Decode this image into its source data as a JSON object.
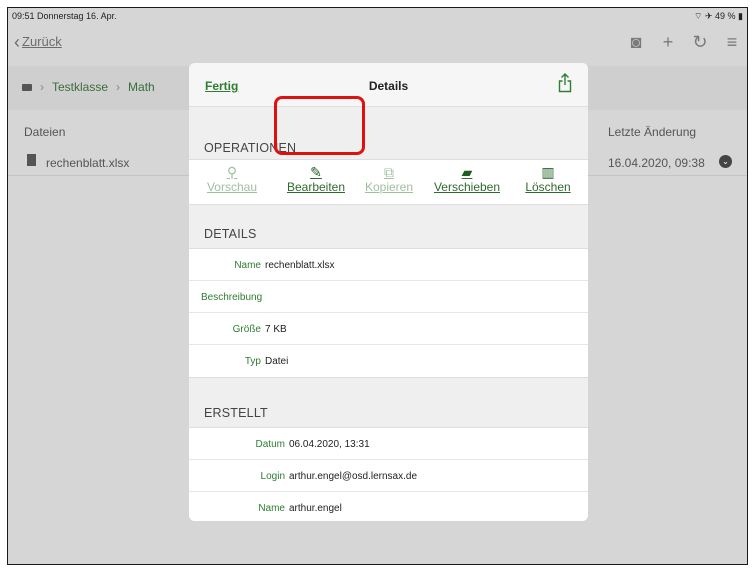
{
  "status": {
    "time_date": "09:51  Donnerstag 16. Apr.",
    "indicators": "⌔ ✈ 49 % ▮"
  },
  "nav": {
    "back_label": "Zurück",
    "icons": [
      "camera-icon",
      "plus-icon",
      "refresh-icon",
      "menu-icon"
    ]
  },
  "breadcrumb": {
    "items": [
      "Testklasse",
      "Math"
    ]
  },
  "list": {
    "header_files": "Dateien",
    "header_modified": "Letzte Änderung",
    "files": [
      {
        "name": "rechenblatt.xlsx",
        "modified": "16.04.2020, 09:38"
      }
    ]
  },
  "modal": {
    "done_label": "Fertig",
    "title": "Details",
    "operations_header": "OPERATIONEN",
    "operations": [
      {
        "label": "Vorschau",
        "icon": "search-icon",
        "enabled": false
      },
      {
        "label": "Bearbeiten",
        "icon": "pencil-icon",
        "enabled": true
      },
      {
        "label": "Kopieren",
        "icon": "copy-icon",
        "enabled": false
      },
      {
        "label": "Verschieben",
        "icon": "folder-move-icon",
        "enabled": true
      },
      {
        "label": "Löschen",
        "icon": "trash-icon",
        "enabled": true
      }
    ],
    "details_header": "DETAILS",
    "details": [
      {
        "key": "Name",
        "value": "rechenblatt.xlsx"
      },
      {
        "key": "Beschreibung",
        "value": ""
      },
      {
        "key": "Größe",
        "value": "7 KB"
      },
      {
        "key": "Typ",
        "value": "Datei"
      }
    ],
    "created_header": "ERSTELLT",
    "created": [
      {
        "key": "Datum",
        "value": "06.04.2020, 13:31"
      },
      {
        "key": "Login",
        "value": "arthur.engel@osd.lernsax.de"
      },
      {
        "key": "Name",
        "value": "arthur.engel"
      }
    ]
  },
  "colors": {
    "accent": "#2e7d32",
    "highlight": "#e01010"
  }
}
